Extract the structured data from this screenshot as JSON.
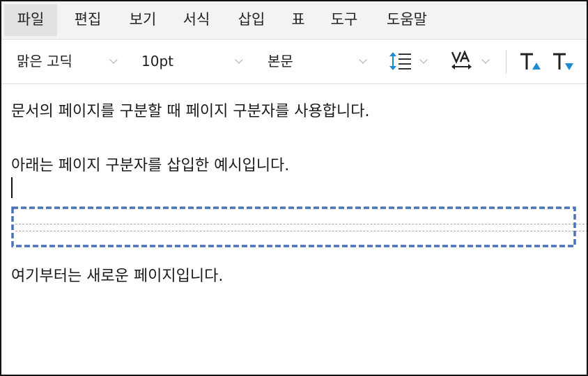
{
  "menu": {
    "items": [
      {
        "label": "파일",
        "active": true
      },
      {
        "label": "편집"
      },
      {
        "label": "보기"
      },
      {
        "label": "서식"
      },
      {
        "label": "삽입"
      },
      {
        "label": "표"
      },
      {
        "label": "도구"
      },
      {
        "label": "도움말"
      }
    ]
  },
  "toolbar": {
    "font_name": "맑은 고딕",
    "font_size": "10pt",
    "style": "본문",
    "icons": [
      "line-spacing-icon",
      "char-spacing-icon",
      "superscript-icon",
      "subscript-icon"
    ],
    "accent_color": "#1e8ad6"
  },
  "document": {
    "lines": [
      "문서의 페이지를 구분할 때 페이지 구분자를 사용합니다.",
      "아래는 페이지 구분자를 삽입한 예시입니다.",
      "여기부터는 새로운 페이지입니다."
    ],
    "page_break_highlight_color": "#4a72b8"
  }
}
